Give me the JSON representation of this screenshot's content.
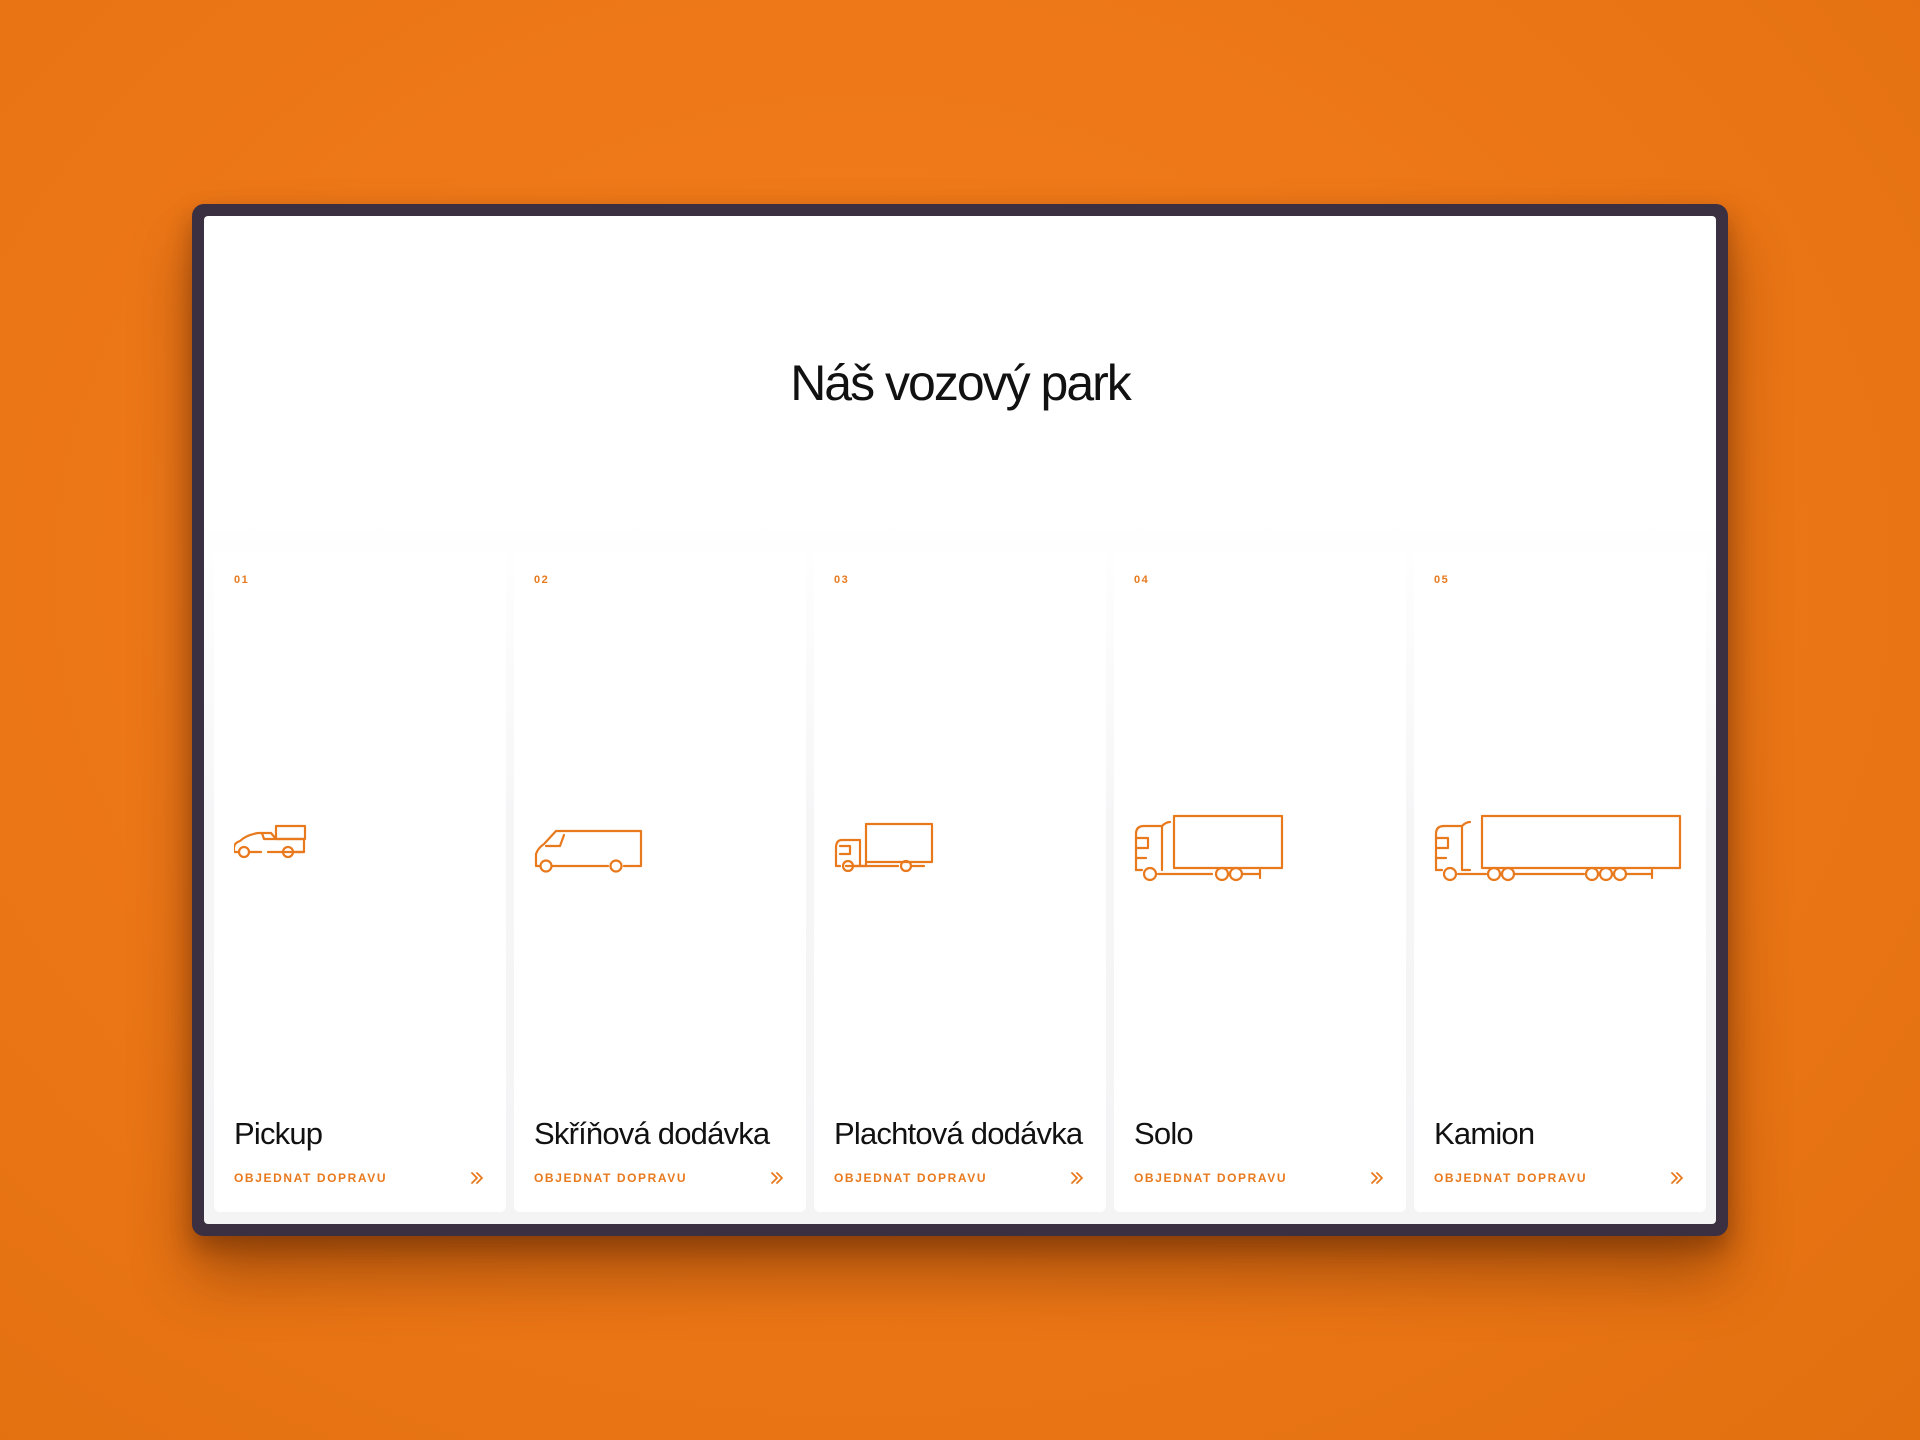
{
  "page": {
    "title": "Náš vozový park"
  },
  "vehicles": [
    {
      "number": "01",
      "name": "Pickup",
      "cta": "OBJEDNAT DOPRAVU",
      "icon": "pickup-icon"
    },
    {
      "number": "02",
      "name": "Skříňová dodávka",
      "cta": "OBJEDNAT DOPRAVU",
      "icon": "box-van-icon"
    },
    {
      "number": "03",
      "name": "Plachtová dodávka",
      "cta": "OBJEDNAT DOPRAVU",
      "icon": "tarp-truck-icon"
    },
    {
      "number": "04",
      "name": "Solo",
      "cta": "OBJEDNAT DOPRAVU",
      "icon": "solo-truck-icon"
    },
    {
      "number": "05",
      "name": "Kamion",
      "cta": "OBJEDNAT DOPRAVU",
      "icon": "semi-truck-icon"
    }
  ],
  "colors": {
    "accent": "#e8791d",
    "background": "#ef7a19",
    "frame": "#3b2f42",
    "text": "#111111"
  }
}
